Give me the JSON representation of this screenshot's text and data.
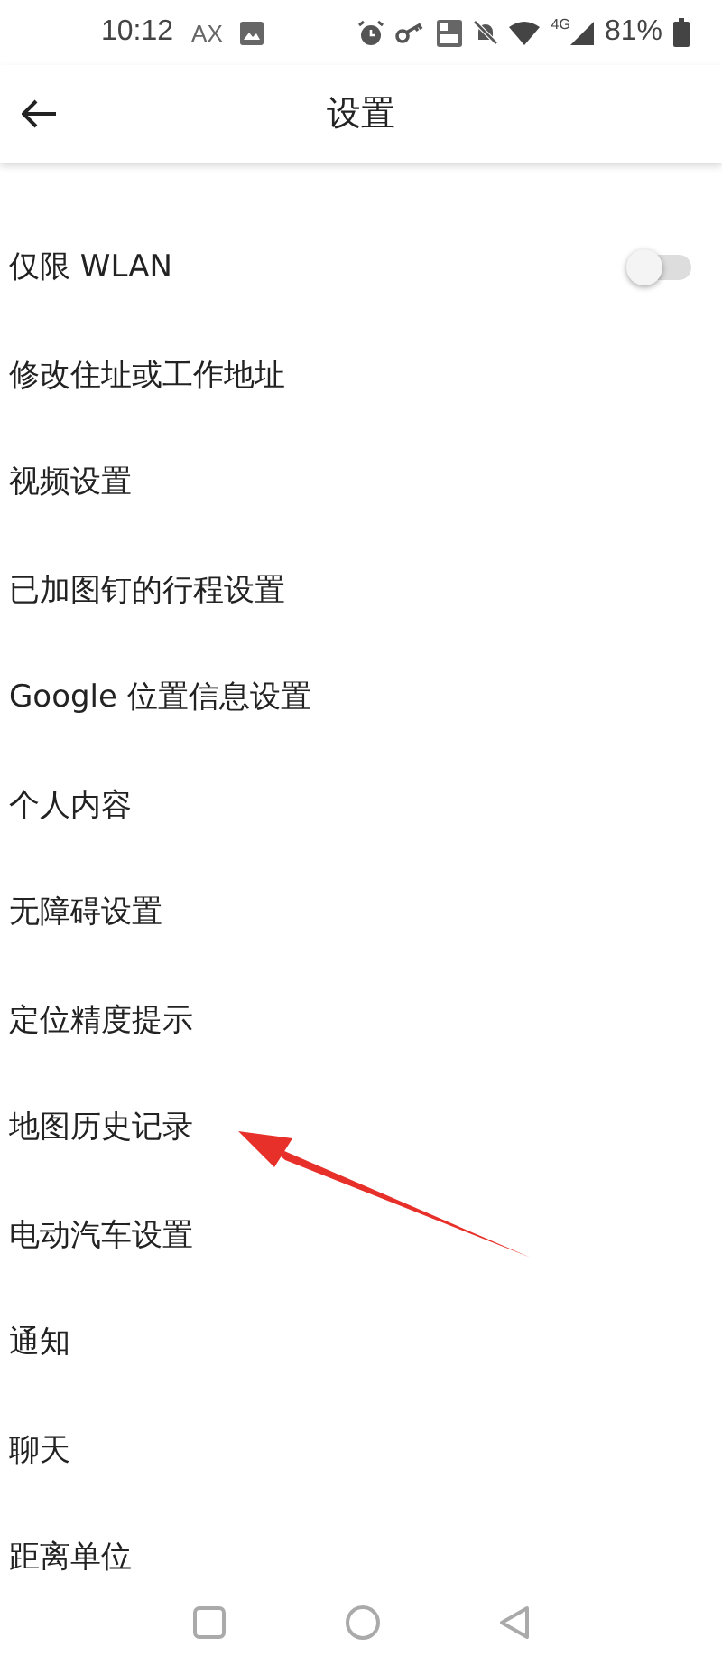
{
  "status_bar": {
    "time": "10:12",
    "carrier": "AX",
    "battery": "81%",
    "network": "4G"
  },
  "toolbar": {
    "title": "设置"
  },
  "items": [
    {
      "label": "仅限 WLAN",
      "kind": "toggle",
      "on": false
    },
    {
      "label": "修改住址或工作地址",
      "kind": "link"
    },
    {
      "label": "视频设置",
      "kind": "link"
    },
    {
      "label": "已加图钉的行程设置",
      "kind": "link"
    },
    {
      "label": "Google 位置信息设置",
      "kind": "link"
    },
    {
      "label": "个人内容",
      "kind": "link"
    },
    {
      "label": "无障碍设置",
      "kind": "link"
    },
    {
      "label": "定位精度提示",
      "kind": "link"
    },
    {
      "label": "地图历史记录",
      "kind": "link"
    },
    {
      "label": "电动汽车设置",
      "kind": "link"
    },
    {
      "label": "通知",
      "kind": "link"
    },
    {
      "label": "聊天",
      "kind": "link"
    },
    {
      "label": "距离单位",
      "kind": "link"
    }
  ]
}
